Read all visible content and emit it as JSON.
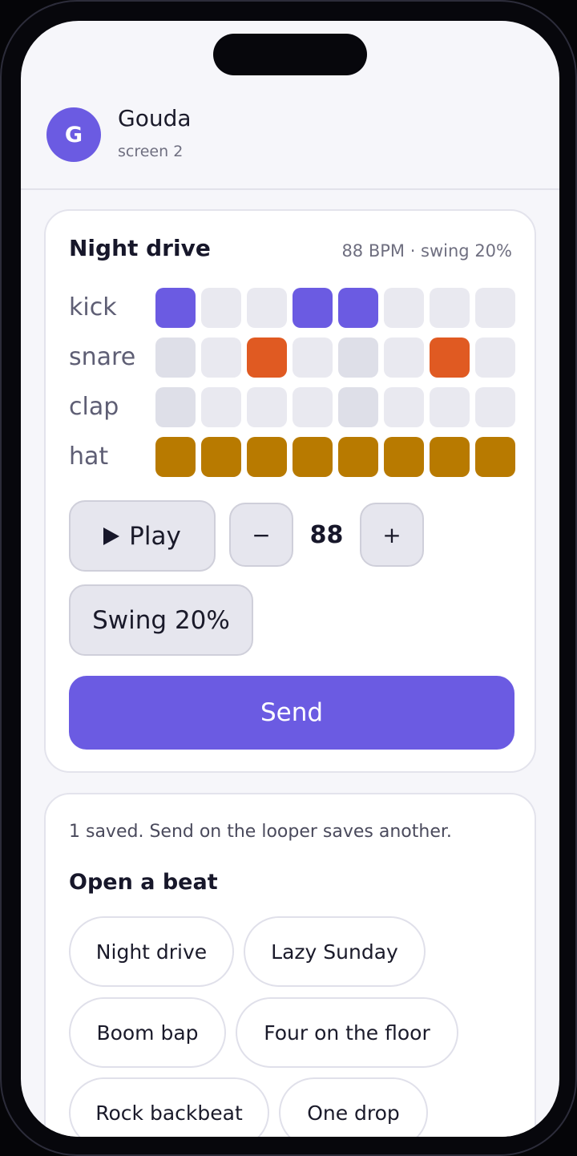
{
  "contact": {
    "initial": "G",
    "name": "Gouda",
    "subtitle": "screen 2"
  },
  "looper": {
    "title": "Night drive",
    "meta": "88 BPM · swing 20%",
    "tracks": [
      {
        "name": "kick",
        "color": "#6b5be2",
        "steps": [
          1,
          0,
          0,
          1,
          1,
          0,
          0,
          0
        ]
      },
      {
        "name": "snare",
        "color": "#e05a22",
        "steps": [
          0,
          0,
          1,
          0,
          0,
          0,
          1,
          0
        ]
      },
      {
        "name": "clap",
        "color": "#6b5be2",
        "steps": [
          0,
          0,
          0,
          0,
          0,
          0,
          0,
          0
        ]
      },
      {
        "name": "hat",
        "color": "#b87a00",
        "steps": [
          1,
          1,
          1,
          1,
          1,
          1,
          1,
          1
        ]
      }
    ],
    "play_label": "Play",
    "minus_label": "−",
    "bpm": "88",
    "plus_label": "+",
    "swing_label": "Swing 20%",
    "send_label": "Send"
  },
  "beats": {
    "saved_note": "1 saved. Send on the looper saves another.",
    "section_title": "Open a beat",
    "items": [
      {
        "label": "Night drive"
      },
      {
        "label": "Lazy Sunday"
      },
      {
        "label": "Boom bap"
      },
      {
        "label": "Four on the floor"
      },
      {
        "label": "Rock backbeat"
      },
      {
        "label": "One drop"
      }
    ]
  }
}
